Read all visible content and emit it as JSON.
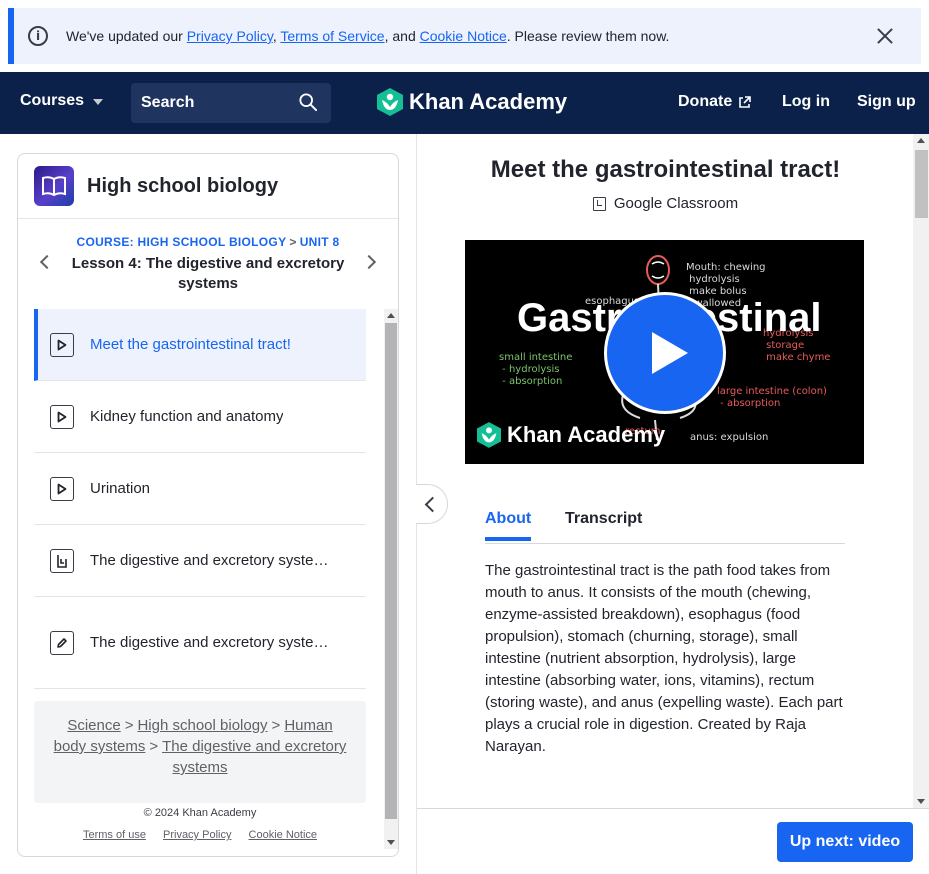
{
  "banner": {
    "prefix": "We've updated our ",
    "privacy_link": "Privacy Policy",
    "comma": ", ",
    "terms_link": "Terms of Service",
    "and": ", and ",
    "cookie_link": "Cookie Notice",
    "suffix": ". Please review them now."
  },
  "nav": {
    "courses": "Courses",
    "search_label": "Search",
    "logo": "Khan Academy",
    "donate": "Donate",
    "login": "Log in",
    "signup": "Sign up"
  },
  "sidebar": {
    "course_title": "High school biology",
    "crumb_course": "COURSE: HIGH SCHOOL BIOLOGY",
    "crumb_sep": ">",
    "crumb_unit": "UNIT 8",
    "lesson_title": "Lesson 4: The digestive and excretory systems",
    "items": [
      {
        "label": "Meet the gastrointestinal tract!",
        "type": "video",
        "active": true
      },
      {
        "label": "Kidney function and anatomy",
        "type": "video"
      },
      {
        "label": "Urination",
        "type": "video"
      },
      {
        "label": "The digestive and excretory systems",
        "type": "article"
      },
      {
        "label": "The digestive and excretory systems",
        "type": "exercise"
      }
    ],
    "breadcrumbs": [
      "Science",
      "High school biology",
      "Human body systems",
      "The digestive and excretory systems"
    ],
    "breadcrumb_sep": ">",
    "copyright": "© 2024 Khan Academy",
    "footer_links": [
      "Terms of use",
      "Privacy Policy",
      "Cookie Notice"
    ]
  },
  "main": {
    "title": "Meet the gastrointestinal tract!",
    "google_classroom": "Google Classroom",
    "video": {
      "big_text": "Gastrointestinal",
      "logo": "Khan Academy",
      "chalk_mouth": "Mouth: chewing\n hydrolysis\n make bolus\n swallowed",
      "chalk_esophagus": "esophagus",
      "chalk_small": "small intestine\n - hydrolysis\n - absorption",
      "chalk_stomach": "hydrolysis\n storage\n make chyme",
      "chalk_large": "large intestine (colon)\n - absorption",
      "chalk_rectum": "rectum",
      "chalk_anus": "anus: expulsion"
    },
    "tabs": [
      "About",
      "Transcript"
    ],
    "description": "The gastrointestinal tract is the path food takes from mouth to anus. It consists of the mouth (chewing, enzyme-assisted breakdown), esophagus (food propulsion), stomach (churning, storage), small intestine (nutrient absorption, hydrolysis), large intestine (absorbing water, ions, vitamins), rectum (storing waste), and anus (expelling waste). Each part plays a crucial role in digestion. Created by Raja Narayan.",
    "up_next": "Up next: video"
  },
  "colors": {
    "brand_blue": "#1865f2",
    "nav_bg": "#0b2149",
    "logo_green": "#14bf96"
  }
}
